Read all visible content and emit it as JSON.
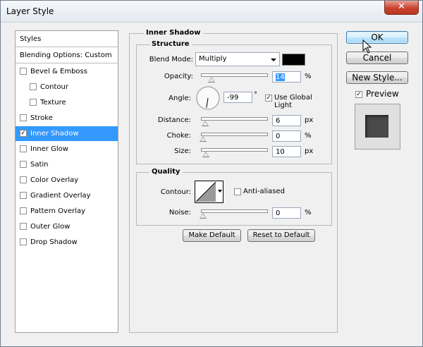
{
  "window": {
    "title": "Layer Style",
    "close_glyph": "✕"
  },
  "left_panel": {
    "header": "Styles",
    "blending": "Blending Options: Custom",
    "items": [
      {
        "label": "Bevel & Emboss",
        "checked": false,
        "indent": false
      },
      {
        "label": "Contour",
        "checked": false,
        "indent": true
      },
      {
        "label": "Texture",
        "checked": false,
        "indent": true
      },
      {
        "label": "Stroke",
        "checked": false,
        "indent": false
      },
      {
        "label": "Inner Shadow",
        "checked": true,
        "indent": false,
        "selected": true
      },
      {
        "label": "Inner Glow",
        "checked": false,
        "indent": false
      },
      {
        "label": "Satin",
        "checked": false,
        "indent": false
      },
      {
        "label": "Color Overlay",
        "checked": false,
        "indent": false
      },
      {
        "label": "Gradient Overlay",
        "checked": false,
        "indent": false
      },
      {
        "label": "Pattern Overlay",
        "checked": false,
        "indent": false
      },
      {
        "label": "Outer Glow",
        "checked": false,
        "indent": false
      },
      {
        "label": "Drop Shadow",
        "checked": false,
        "indent": false
      }
    ]
  },
  "main": {
    "section_title": "Inner Shadow",
    "structure": {
      "title": "Structure",
      "blend_mode_label": "Blend Mode:",
      "blend_mode_value": "Multiply",
      "shadow_color": "#000000",
      "opacity": {
        "label": "Opacity:",
        "value": "14",
        "unit": "%",
        "slider_fraction": 0.14
      },
      "angle": {
        "label": "Angle:",
        "value": "-99",
        "unit": "°",
        "degrees": -99
      },
      "use_global_light": {
        "label": "Use Global Light",
        "checked": true
      },
      "distance": {
        "label": "Distance:",
        "value": "6",
        "unit": "px",
        "slider_fraction": 0.03
      },
      "choke": {
        "label": "Choke:",
        "value": "0",
        "unit": "%",
        "slider_fraction": 0.0
      },
      "size": {
        "label": "Size:",
        "value": "10",
        "unit": "px",
        "slider_fraction": 0.05
      }
    },
    "quality": {
      "title": "Quality",
      "contour_label": "Contour:",
      "anti_aliased": {
        "label": "Anti-aliased",
        "checked": false
      },
      "noise": {
        "label": "Noise:",
        "value": "0",
        "unit": "%",
        "slider_fraction": 0.0
      }
    },
    "make_default": "Make Default",
    "reset_default": "Reset to Default"
  },
  "right": {
    "ok": "OK",
    "cancel": "Cancel",
    "new_style": "New Style...",
    "preview": {
      "label": "Preview",
      "checked": true
    }
  }
}
